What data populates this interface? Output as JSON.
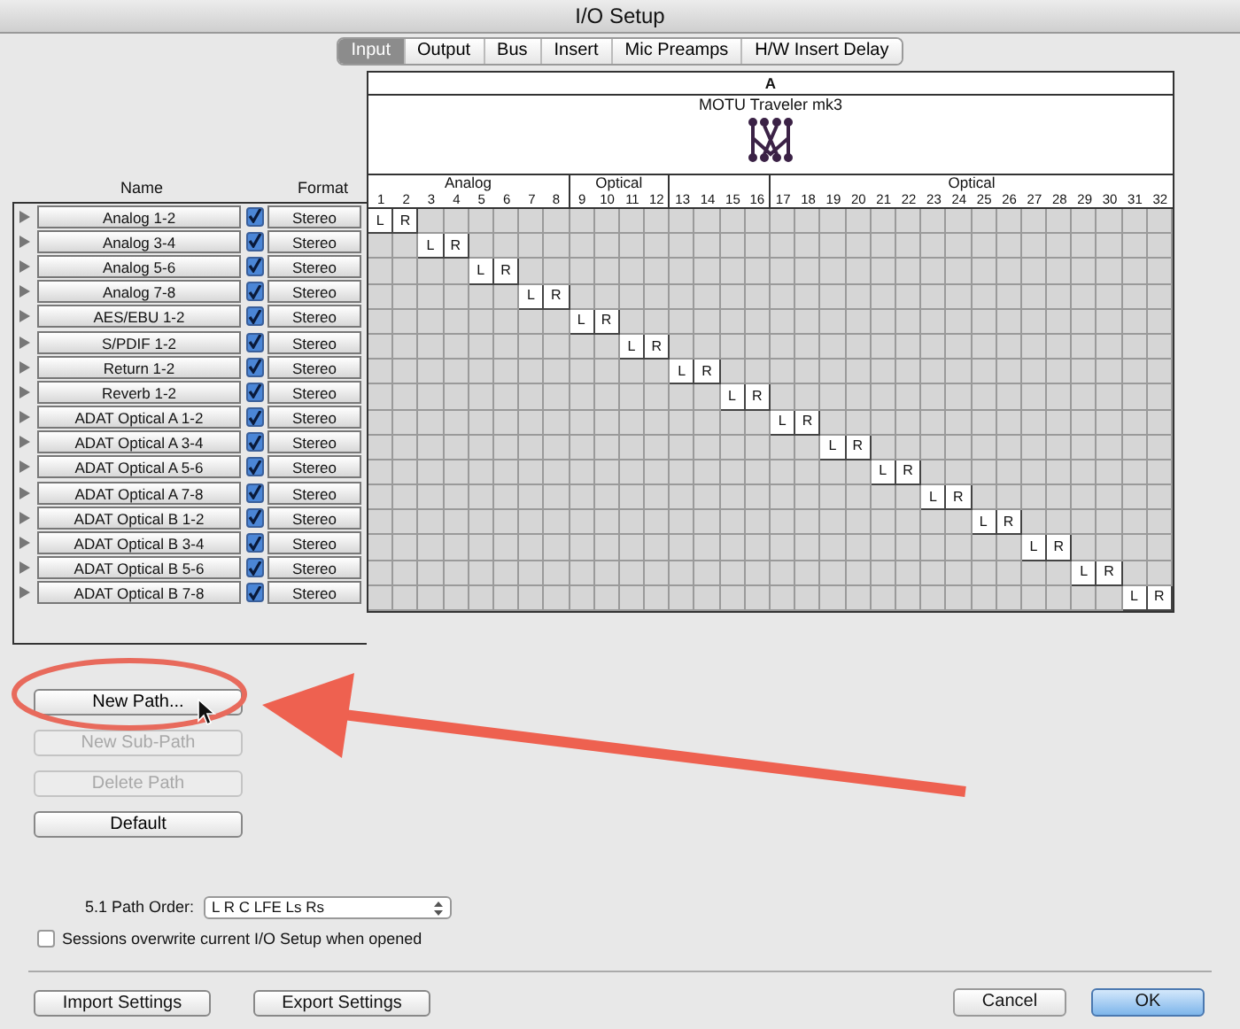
{
  "window": {
    "title": "I/O Setup"
  },
  "tabs": [
    {
      "label": "Input",
      "selected": true
    },
    {
      "label": "Output",
      "selected": false
    },
    {
      "label": "Bus",
      "selected": false
    },
    {
      "label": "Insert",
      "selected": false
    },
    {
      "label": "Mic Preamps",
      "selected": false
    },
    {
      "label": "H/W Insert Delay",
      "selected": false
    }
  ],
  "grid": {
    "bank": "A",
    "device": "MOTU Traveler mk3",
    "groups": [
      {
        "label": "Analog",
        "channels": [
          "1",
          "2",
          "3",
          "4",
          "5",
          "6",
          "7",
          "8"
        ]
      },
      {
        "label": "Optical",
        "channels": [
          "9",
          "10",
          "11",
          "12"
        ]
      },
      {
        "channels": [
          "13",
          "14",
          "15",
          "16"
        ]
      },
      {
        "label": "Optical",
        "channels": [
          "17",
          "18",
          "19",
          "20",
          "21",
          "22",
          "23",
          "24",
          "25",
          "26",
          "27",
          "28",
          "29",
          "30",
          "31",
          "32"
        ]
      }
    ]
  },
  "columns": [
    "Name",
    "Format"
  ],
  "rows": [
    {
      "name": "Analog 1-2",
      "active": true,
      "format": "Stereo",
      "cells": [
        {
          "on": true,
          "label": "L"
        },
        {
          "on": true,
          "label": "R"
        },
        {
          "on": false
        },
        {
          "on": false
        },
        {
          "on": false
        },
        {
          "on": false
        },
        {
          "on": false
        },
        {
          "on": false
        },
        {
          "on": false
        },
        {
          "on": false
        },
        {
          "on": false
        },
        {
          "on": false
        },
        {
          "on": false
        },
        {
          "on": false
        },
        {
          "on": false
        },
        {
          "on": false
        },
        {
          "on": false
        },
        {
          "on": false
        },
        {
          "on": false
        },
        {
          "on": false
        },
        {
          "on": false
        },
        {
          "on": false
        },
        {
          "on": false
        },
        {
          "on": false
        },
        {
          "on": false
        },
        {
          "on": false
        },
        {
          "on": false
        },
        {
          "on": false
        },
        {
          "on": false
        },
        {
          "on": false
        },
        {
          "on": false
        },
        {
          "on": false
        }
      ]
    },
    {
      "name": "Analog 3-4",
      "active": true,
      "format": "Stereo",
      "cells": [
        {
          "on": false
        },
        {
          "on": false
        },
        {
          "on": true,
          "label": "L"
        },
        {
          "on": true,
          "label": "R"
        },
        {
          "on": false
        },
        {
          "on": false
        },
        {
          "on": false
        },
        {
          "on": false
        },
        {
          "on": false
        },
        {
          "on": false
        },
        {
          "on": false
        },
        {
          "on": false
        },
        {
          "on": false
        },
        {
          "on": false
        },
        {
          "on": false
        },
        {
          "on": false
        },
        {
          "on": false
        },
        {
          "on": false
        },
        {
          "on": false
        },
        {
          "on": false
        },
        {
          "on": false
        },
        {
          "on": false
        },
        {
          "on": false
        },
        {
          "on": false
        },
        {
          "on": false
        },
        {
          "on": false
        },
        {
          "on": false
        },
        {
          "on": false
        },
        {
          "on": false
        },
        {
          "on": false
        },
        {
          "on": false
        },
        {
          "on": false
        }
      ]
    },
    {
      "name": "Analog 5-6",
      "active": true,
      "format": "Stereo",
      "cells": [
        {
          "on": false
        },
        {
          "on": false
        },
        {
          "on": false
        },
        {
          "on": false
        },
        {
          "on": true,
          "label": "L"
        },
        {
          "on": true,
          "label": "R"
        },
        {
          "on": false
        },
        {
          "on": false
        },
        {
          "on": false
        },
        {
          "on": false
        },
        {
          "on": false
        },
        {
          "on": false
        },
        {
          "on": false
        },
        {
          "on": false
        },
        {
          "on": false
        },
        {
          "on": false
        },
        {
          "on": false
        },
        {
          "on": false
        },
        {
          "on": false
        },
        {
          "on": false
        },
        {
          "on": false
        },
        {
          "on": false
        },
        {
          "on": false
        },
        {
          "on": false
        },
        {
          "on": false
        },
        {
          "on": false
        },
        {
          "on": false
        },
        {
          "on": false
        },
        {
          "on": false
        },
        {
          "on": false
        },
        {
          "on": false
        },
        {
          "on": false
        }
      ]
    },
    {
      "name": "Analog 7-8",
      "active": true,
      "format": "Stereo",
      "cells": [
        {
          "on": false
        },
        {
          "on": false
        },
        {
          "on": false
        },
        {
          "on": false
        },
        {
          "on": false
        },
        {
          "on": false
        },
        {
          "on": true,
          "label": "L"
        },
        {
          "on": true,
          "label": "R"
        },
        {
          "on": false
        },
        {
          "on": false
        },
        {
          "on": false
        },
        {
          "on": false
        },
        {
          "on": false
        },
        {
          "on": false
        },
        {
          "on": false
        },
        {
          "on": false
        },
        {
          "on": false
        },
        {
          "on": false
        },
        {
          "on": false
        },
        {
          "on": false
        },
        {
          "on": false
        },
        {
          "on": false
        },
        {
          "on": false
        },
        {
          "on": false
        },
        {
          "on": false
        },
        {
          "on": false
        },
        {
          "on": false
        },
        {
          "on": false
        },
        {
          "on": false
        },
        {
          "on": false
        },
        {
          "on": false
        },
        {
          "on": false
        }
      ]
    },
    {
      "name": "AES/EBU 1-2",
      "active": true,
      "format": "Stereo",
      "cells": [
        {
          "on": false
        },
        {
          "on": false
        },
        {
          "on": false
        },
        {
          "on": false
        },
        {
          "on": false
        },
        {
          "on": false
        },
        {
          "on": false
        },
        {
          "on": false
        },
        {
          "on": true,
          "label": "L"
        },
        {
          "on": true,
          "label": "R"
        },
        {
          "on": false
        },
        {
          "on": false
        },
        {
          "on": false
        },
        {
          "on": false
        },
        {
          "on": false
        },
        {
          "on": false
        },
        {
          "on": false
        },
        {
          "on": false
        },
        {
          "on": false
        },
        {
          "on": false
        },
        {
          "on": false
        },
        {
          "on": false
        },
        {
          "on": false
        },
        {
          "on": false
        },
        {
          "on": false
        },
        {
          "on": false
        },
        {
          "on": false
        },
        {
          "on": false
        },
        {
          "on": false
        },
        {
          "on": false
        },
        {
          "on": false
        },
        {
          "on": false
        }
      ]
    },
    {
      "name": "S/PDIF 1-2",
      "active": true,
      "format": "Stereo",
      "cells": [
        {
          "on": false
        },
        {
          "on": false
        },
        {
          "on": false
        },
        {
          "on": false
        },
        {
          "on": false
        },
        {
          "on": false
        },
        {
          "on": false
        },
        {
          "on": false
        },
        {
          "on": false
        },
        {
          "on": false
        },
        {
          "on": true,
          "label": "L"
        },
        {
          "on": true,
          "label": "R"
        },
        {
          "on": false
        },
        {
          "on": false
        },
        {
          "on": false
        },
        {
          "on": false
        },
        {
          "on": false
        },
        {
          "on": false
        },
        {
          "on": false
        },
        {
          "on": false
        },
        {
          "on": false
        },
        {
          "on": false
        },
        {
          "on": false
        },
        {
          "on": false
        },
        {
          "on": false
        },
        {
          "on": false
        },
        {
          "on": false
        },
        {
          "on": false
        },
        {
          "on": false
        },
        {
          "on": false
        },
        {
          "on": false
        },
        {
          "on": false
        }
      ]
    },
    {
      "name": "Return 1-2",
      "active": true,
      "format": "Stereo",
      "cells": [
        {
          "on": false
        },
        {
          "on": false
        },
        {
          "on": false
        },
        {
          "on": false
        },
        {
          "on": false
        },
        {
          "on": false
        },
        {
          "on": false
        },
        {
          "on": false
        },
        {
          "on": false
        },
        {
          "on": false
        },
        {
          "on": false
        },
        {
          "on": false
        },
        {
          "on": true,
          "label": "L"
        },
        {
          "on": true,
          "label": "R"
        },
        {
          "on": false
        },
        {
          "on": false
        },
        {
          "on": false
        },
        {
          "on": false
        },
        {
          "on": false
        },
        {
          "on": false
        },
        {
          "on": false
        },
        {
          "on": false
        },
        {
          "on": false
        },
        {
          "on": false
        },
        {
          "on": false
        },
        {
          "on": false
        },
        {
          "on": false
        },
        {
          "on": false
        },
        {
          "on": false
        },
        {
          "on": false
        },
        {
          "on": false
        },
        {
          "on": false
        }
      ]
    },
    {
      "name": "Reverb 1-2",
      "active": true,
      "format": "Stereo",
      "cells": [
        {
          "on": false
        },
        {
          "on": false
        },
        {
          "on": false
        },
        {
          "on": false
        },
        {
          "on": false
        },
        {
          "on": false
        },
        {
          "on": false
        },
        {
          "on": false
        },
        {
          "on": false
        },
        {
          "on": false
        },
        {
          "on": false
        },
        {
          "on": false
        },
        {
          "on": false
        },
        {
          "on": false
        },
        {
          "on": true,
          "label": "L"
        },
        {
          "on": true,
          "label": "R"
        },
        {
          "on": false
        },
        {
          "on": false
        },
        {
          "on": false
        },
        {
          "on": false
        },
        {
          "on": false
        },
        {
          "on": false
        },
        {
          "on": false
        },
        {
          "on": false
        },
        {
          "on": false
        },
        {
          "on": false
        },
        {
          "on": false
        },
        {
          "on": false
        },
        {
          "on": false
        },
        {
          "on": false
        },
        {
          "on": false
        },
        {
          "on": false
        }
      ]
    },
    {
      "name": "ADAT Optical A 1-2",
      "active": true,
      "format": "Stereo",
      "cells": [
        {
          "on": false
        },
        {
          "on": false
        },
        {
          "on": false
        },
        {
          "on": false
        },
        {
          "on": false
        },
        {
          "on": false
        },
        {
          "on": false
        },
        {
          "on": false
        },
        {
          "on": false
        },
        {
          "on": false
        },
        {
          "on": false
        },
        {
          "on": false
        },
        {
          "on": false
        },
        {
          "on": false
        },
        {
          "on": false
        },
        {
          "on": false
        },
        {
          "on": true,
          "label": "L"
        },
        {
          "on": true,
          "label": "R"
        },
        {
          "on": false
        },
        {
          "on": false
        },
        {
          "on": false
        },
        {
          "on": false
        },
        {
          "on": false
        },
        {
          "on": false
        },
        {
          "on": false
        },
        {
          "on": false
        },
        {
          "on": false
        },
        {
          "on": false
        },
        {
          "on": false
        },
        {
          "on": false
        },
        {
          "on": false
        },
        {
          "on": false
        }
      ]
    },
    {
      "name": "ADAT Optical A 3-4",
      "active": true,
      "format": "Stereo",
      "cells": [
        {
          "on": false
        },
        {
          "on": false
        },
        {
          "on": false
        },
        {
          "on": false
        },
        {
          "on": false
        },
        {
          "on": false
        },
        {
          "on": false
        },
        {
          "on": false
        },
        {
          "on": false
        },
        {
          "on": false
        },
        {
          "on": false
        },
        {
          "on": false
        },
        {
          "on": false
        },
        {
          "on": false
        },
        {
          "on": false
        },
        {
          "on": false
        },
        {
          "on": false
        },
        {
          "on": false
        },
        {
          "on": true,
          "label": "L"
        },
        {
          "on": true,
          "label": "R"
        },
        {
          "on": false
        },
        {
          "on": false
        },
        {
          "on": false
        },
        {
          "on": false
        },
        {
          "on": false
        },
        {
          "on": false
        },
        {
          "on": false
        },
        {
          "on": false
        },
        {
          "on": false
        },
        {
          "on": false
        },
        {
          "on": false
        },
        {
          "on": false
        }
      ]
    },
    {
      "name": "ADAT Optical A 5-6",
      "active": true,
      "format": "Stereo",
      "cells": [
        {
          "on": false
        },
        {
          "on": false
        },
        {
          "on": false
        },
        {
          "on": false
        },
        {
          "on": false
        },
        {
          "on": false
        },
        {
          "on": false
        },
        {
          "on": false
        },
        {
          "on": false
        },
        {
          "on": false
        },
        {
          "on": false
        },
        {
          "on": false
        },
        {
          "on": false
        },
        {
          "on": false
        },
        {
          "on": false
        },
        {
          "on": false
        },
        {
          "on": false
        },
        {
          "on": false
        },
        {
          "on": false
        },
        {
          "on": false
        },
        {
          "on": true,
          "label": "L"
        },
        {
          "on": true,
          "label": "R"
        },
        {
          "on": false
        },
        {
          "on": false
        },
        {
          "on": false
        },
        {
          "on": false
        },
        {
          "on": false
        },
        {
          "on": false
        },
        {
          "on": false
        },
        {
          "on": false
        },
        {
          "on": false
        },
        {
          "on": false
        }
      ]
    },
    {
      "name": "ADAT Optical A 7-8",
      "active": true,
      "format": "Stereo",
      "cells": [
        {
          "on": false
        },
        {
          "on": false
        },
        {
          "on": false
        },
        {
          "on": false
        },
        {
          "on": false
        },
        {
          "on": false
        },
        {
          "on": false
        },
        {
          "on": false
        },
        {
          "on": false
        },
        {
          "on": false
        },
        {
          "on": false
        },
        {
          "on": false
        },
        {
          "on": false
        },
        {
          "on": false
        },
        {
          "on": false
        },
        {
          "on": false
        },
        {
          "on": false
        },
        {
          "on": false
        },
        {
          "on": false
        },
        {
          "on": false
        },
        {
          "on": false
        },
        {
          "on": false
        },
        {
          "on": true,
          "label": "L"
        },
        {
          "on": true,
          "label": "R"
        },
        {
          "on": false
        },
        {
          "on": false
        },
        {
          "on": false
        },
        {
          "on": false
        },
        {
          "on": false
        },
        {
          "on": false
        },
        {
          "on": false
        },
        {
          "on": false
        }
      ]
    },
    {
      "name": "ADAT Optical B 1-2",
      "active": true,
      "format": "Stereo",
      "cells": [
        {
          "on": false
        },
        {
          "on": false
        },
        {
          "on": false
        },
        {
          "on": false
        },
        {
          "on": false
        },
        {
          "on": false
        },
        {
          "on": false
        },
        {
          "on": false
        },
        {
          "on": false
        },
        {
          "on": false
        },
        {
          "on": false
        },
        {
          "on": false
        },
        {
          "on": false
        },
        {
          "on": false
        },
        {
          "on": false
        },
        {
          "on": false
        },
        {
          "on": false
        },
        {
          "on": false
        },
        {
          "on": false
        },
        {
          "on": false
        },
        {
          "on": false
        },
        {
          "on": false
        },
        {
          "on": false
        },
        {
          "on": false
        },
        {
          "on": true,
          "label": "L"
        },
        {
          "on": true,
          "label": "R"
        },
        {
          "on": false
        },
        {
          "on": false
        },
        {
          "on": false
        },
        {
          "on": false
        },
        {
          "on": false
        },
        {
          "on": false
        }
      ]
    },
    {
      "name": "ADAT Optical B 3-4",
      "active": true,
      "format": "Stereo",
      "cells": [
        {
          "on": false
        },
        {
          "on": false
        },
        {
          "on": false
        },
        {
          "on": false
        },
        {
          "on": false
        },
        {
          "on": false
        },
        {
          "on": false
        },
        {
          "on": false
        },
        {
          "on": false
        },
        {
          "on": false
        },
        {
          "on": false
        },
        {
          "on": false
        },
        {
          "on": false
        },
        {
          "on": false
        },
        {
          "on": false
        },
        {
          "on": false
        },
        {
          "on": false
        },
        {
          "on": false
        },
        {
          "on": false
        },
        {
          "on": false
        },
        {
          "on": false
        },
        {
          "on": false
        },
        {
          "on": false
        },
        {
          "on": false
        },
        {
          "on": false
        },
        {
          "on": false
        },
        {
          "on": true,
          "label": "L"
        },
        {
          "on": true,
          "label": "R"
        },
        {
          "on": false
        },
        {
          "on": false
        },
        {
          "on": false
        },
        {
          "on": false
        }
      ]
    },
    {
      "name": "ADAT Optical B 5-6",
      "active": true,
      "format": "Stereo",
      "cells": [
        {
          "on": false
        },
        {
          "on": false
        },
        {
          "on": false
        },
        {
          "on": false
        },
        {
          "on": false
        },
        {
          "on": false
        },
        {
          "on": false
        },
        {
          "on": false
        },
        {
          "on": false
        },
        {
          "on": false
        },
        {
          "on": false
        },
        {
          "on": false
        },
        {
          "on": false
        },
        {
          "on": false
        },
        {
          "on": false
        },
        {
          "on": false
        },
        {
          "on": false
        },
        {
          "on": false
        },
        {
          "on": false
        },
        {
          "on": false
        },
        {
          "on": false
        },
        {
          "on": false
        },
        {
          "on": false
        },
        {
          "on": false
        },
        {
          "on": false
        },
        {
          "on": false
        },
        {
          "on": false
        },
        {
          "on": false
        },
        {
          "on": true,
          "label": "L"
        },
        {
          "on": true,
          "label": "R"
        },
        {
          "on": false
        },
        {
          "on": false
        }
      ]
    },
    {
      "name": "ADAT Optical B 7-8",
      "active": true,
      "format": "Stereo",
      "cells": [
        {
          "on": false
        },
        {
          "on": false
        },
        {
          "on": false
        },
        {
          "on": false
        },
        {
          "on": false
        },
        {
          "on": false
        },
        {
          "on": false
        },
        {
          "on": false
        },
        {
          "on": false
        },
        {
          "on": false
        },
        {
          "on": false
        },
        {
          "on": false
        },
        {
          "on": false
        },
        {
          "on": false
        },
        {
          "on": false
        },
        {
          "on": false
        },
        {
          "on": false
        },
        {
          "on": false
        },
        {
          "on": false
        },
        {
          "on": false
        },
        {
          "on": false
        },
        {
          "on": false
        },
        {
          "on": false
        },
        {
          "on": false
        },
        {
          "on": false
        },
        {
          "on": false
        },
        {
          "on": false
        },
        {
          "on": false
        },
        {
          "on": false
        },
        {
          "on": false
        },
        {
          "on": true,
          "label": "L"
        },
        {
          "on": true,
          "label": "R"
        }
      ]
    }
  ],
  "path_buttons": [
    {
      "label": "New Path...",
      "disabled": false
    },
    {
      "label": "New Sub-Path",
      "disabled": true
    },
    {
      "label": "Delete Path",
      "disabled": true
    },
    {
      "label": "Default",
      "disabled": false
    }
  ],
  "path_order": {
    "label": "5.1 Path Order:",
    "value": "L R C LFE Ls Rs"
  },
  "overwrite": {
    "label": "Sessions overwrite current I/O Setup when opened",
    "checked": false
  },
  "footer_left": [
    "Import Settings",
    "Export Settings"
  ],
  "footer_right": [
    {
      "label": "Cancel",
      "default": false
    },
    {
      "label": "OK",
      "default": true
    }
  ]
}
